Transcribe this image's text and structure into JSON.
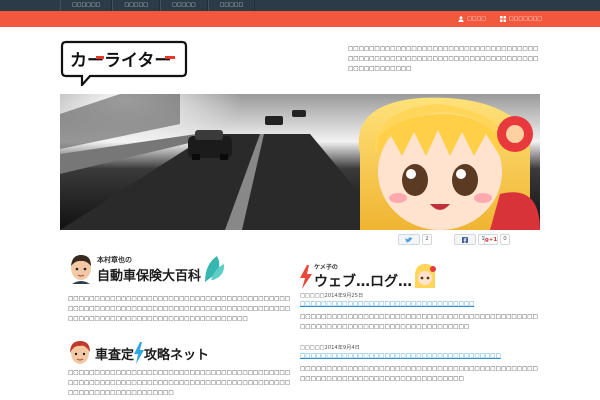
{
  "topnav": {
    "items": [
      "□□□□□□",
      "□□□□□",
      "□□□□□",
      "□□□□□"
    ]
  },
  "redlinks": {
    "contact_label": "□□□□",
    "sitemap_label": "□□□□□□□"
  },
  "logo": {
    "text": "カーライター"
  },
  "site_description": "□□□□□□□□□□□□□□□□□□□□□□□□□□□□□□□□□□□□□□□□□□□□□□□□□□□□□□□□□□□□□□□□□□□□□□□□□□□□□□□□□□□□",
  "share": {
    "twitter_count": "2",
    "facebook_count": "1",
    "gplus_label": "g+1",
    "gplus_count": "0"
  },
  "insurance": {
    "name": "本村章也の",
    "title": "自動車保険大百科",
    "body": "□□□□□□□□□□□□□□□□□□□□□□□□□□□□□□□□□□□□□□□□□□□□□□□□□□□□□□□□□□□□□□□□□□□□□□□□□□□□□□□□□□□□□□□□□□□□□□□□□□□□□□□□□□□□□□□□□□□□□□"
  },
  "assessment": {
    "title_left": "車査定",
    "title_right": "攻略ネット",
    "body": "□□□□□□□□□□□□□□□□□□□□□□□□□□□□□□□□□□□□□□□□□□□□□□□□□□□□□□□□□□□□□□□□□□□□□□□□□□□□□□□□□□□□□□□□□□□□□□□□□□□□□□□□"
  },
  "blog": {
    "owner": "ケメ子の",
    "title": "ウェブ…ログ…",
    "posts": [
      {
        "date": "□□□□□2014年9月25日",
        "title": "□□□□□□□□□□□□□□□□□□□□□□□□□□□□□□□□□",
        "body": "□□□□□□□□□□□□□□□□□□□□□□□□□□□□□□□□□□□□□□□□□□□□□□□□□□□□□□□□□□□□□□□□□□□□□□□□□□□□□"
      },
      {
        "date": "□□□□□2014年9月4日",
        "title": "□□□□□□□□□□□□□□□□□□□□□□□□□□□□□□□□□□□□□□",
        "body": "□□□□□□□□□□□□□□□□□□□□□□□□□□□□□□□□□□□□□□□□□□□□□□□□□□□□□□□□□□□□□□□□□□□□□□□□□□□□"
      }
    ]
  },
  "colors": {
    "topbar": "#2b3c48",
    "redbar": "#f2583e",
    "link": "#2f8fd0",
    "teal": "#36b7b0"
  }
}
